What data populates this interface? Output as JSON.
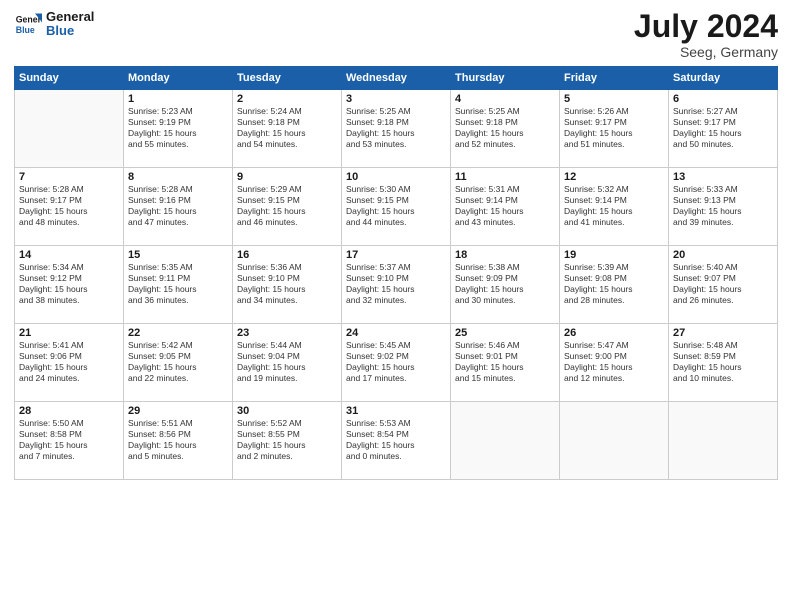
{
  "header": {
    "logo_general": "General",
    "logo_blue": "Blue",
    "month_year": "July 2024",
    "location": "Seeg, Germany"
  },
  "weekdays": [
    "Sunday",
    "Monday",
    "Tuesday",
    "Wednesday",
    "Thursday",
    "Friday",
    "Saturday"
  ],
  "weeks": [
    [
      {
        "day": "",
        "text": ""
      },
      {
        "day": "1",
        "text": "Sunrise: 5:23 AM\nSunset: 9:19 PM\nDaylight: 15 hours\nand 55 minutes."
      },
      {
        "day": "2",
        "text": "Sunrise: 5:24 AM\nSunset: 9:18 PM\nDaylight: 15 hours\nand 54 minutes."
      },
      {
        "day": "3",
        "text": "Sunrise: 5:25 AM\nSunset: 9:18 PM\nDaylight: 15 hours\nand 53 minutes."
      },
      {
        "day": "4",
        "text": "Sunrise: 5:25 AM\nSunset: 9:18 PM\nDaylight: 15 hours\nand 52 minutes."
      },
      {
        "day": "5",
        "text": "Sunrise: 5:26 AM\nSunset: 9:17 PM\nDaylight: 15 hours\nand 51 minutes."
      },
      {
        "day": "6",
        "text": "Sunrise: 5:27 AM\nSunset: 9:17 PM\nDaylight: 15 hours\nand 50 minutes."
      }
    ],
    [
      {
        "day": "7",
        "text": "Sunrise: 5:28 AM\nSunset: 9:17 PM\nDaylight: 15 hours\nand 48 minutes."
      },
      {
        "day": "8",
        "text": "Sunrise: 5:28 AM\nSunset: 9:16 PM\nDaylight: 15 hours\nand 47 minutes."
      },
      {
        "day": "9",
        "text": "Sunrise: 5:29 AM\nSunset: 9:15 PM\nDaylight: 15 hours\nand 46 minutes."
      },
      {
        "day": "10",
        "text": "Sunrise: 5:30 AM\nSunset: 9:15 PM\nDaylight: 15 hours\nand 44 minutes."
      },
      {
        "day": "11",
        "text": "Sunrise: 5:31 AM\nSunset: 9:14 PM\nDaylight: 15 hours\nand 43 minutes."
      },
      {
        "day": "12",
        "text": "Sunrise: 5:32 AM\nSunset: 9:14 PM\nDaylight: 15 hours\nand 41 minutes."
      },
      {
        "day": "13",
        "text": "Sunrise: 5:33 AM\nSunset: 9:13 PM\nDaylight: 15 hours\nand 39 minutes."
      }
    ],
    [
      {
        "day": "14",
        "text": "Sunrise: 5:34 AM\nSunset: 9:12 PM\nDaylight: 15 hours\nand 38 minutes."
      },
      {
        "day": "15",
        "text": "Sunrise: 5:35 AM\nSunset: 9:11 PM\nDaylight: 15 hours\nand 36 minutes."
      },
      {
        "day": "16",
        "text": "Sunrise: 5:36 AM\nSunset: 9:10 PM\nDaylight: 15 hours\nand 34 minutes."
      },
      {
        "day": "17",
        "text": "Sunrise: 5:37 AM\nSunset: 9:10 PM\nDaylight: 15 hours\nand 32 minutes."
      },
      {
        "day": "18",
        "text": "Sunrise: 5:38 AM\nSunset: 9:09 PM\nDaylight: 15 hours\nand 30 minutes."
      },
      {
        "day": "19",
        "text": "Sunrise: 5:39 AM\nSunset: 9:08 PM\nDaylight: 15 hours\nand 28 minutes."
      },
      {
        "day": "20",
        "text": "Sunrise: 5:40 AM\nSunset: 9:07 PM\nDaylight: 15 hours\nand 26 minutes."
      }
    ],
    [
      {
        "day": "21",
        "text": "Sunrise: 5:41 AM\nSunset: 9:06 PM\nDaylight: 15 hours\nand 24 minutes."
      },
      {
        "day": "22",
        "text": "Sunrise: 5:42 AM\nSunset: 9:05 PM\nDaylight: 15 hours\nand 22 minutes."
      },
      {
        "day": "23",
        "text": "Sunrise: 5:44 AM\nSunset: 9:04 PM\nDaylight: 15 hours\nand 19 minutes."
      },
      {
        "day": "24",
        "text": "Sunrise: 5:45 AM\nSunset: 9:02 PM\nDaylight: 15 hours\nand 17 minutes."
      },
      {
        "day": "25",
        "text": "Sunrise: 5:46 AM\nSunset: 9:01 PM\nDaylight: 15 hours\nand 15 minutes."
      },
      {
        "day": "26",
        "text": "Sunrise: 5:47 AM\nSunset: 9:00 PM\nDaylight: 15 hours\nand 12 minutes."
      },
      {
        "day": "27",
        "text": "Sunrise: 5:48 AM\nSunset: 8:59 PM\nDaylight: 15 hours\nand 10 minutes."
      }
    ],
    [
      {
        "day": "28",
        "text": "Sunrise: 5:50 AM\nSunset: 8:58 PM\nDaylight: 15 hours\nand 7 minutes."
      },
      {
        "day": "29",
        "text": "Sunrise: 5:51 AM\nSunset: 8:56 PM\nDaylight: 15 hours\nand 5 minutes."
      },
      {
        "day": "30",
        "text": "Sunrise: 5:52 AM\nSunset: 8:55 PM\nDaylight: 15 hours\nand 2 minutes."
      },
      {
        "day": "31",
        "text": "Sunrise: 5:53 AM\nSunset: 8:54 PM\nDaylight: 15 hours\nand 0 minutes."
      },
      {
        "day": "",
        "text": ""
      },
      {
        "day": "",
        "text": ""
      },
      {
        "day": "",
        "text": ""
      }
    ]
  ]
}
